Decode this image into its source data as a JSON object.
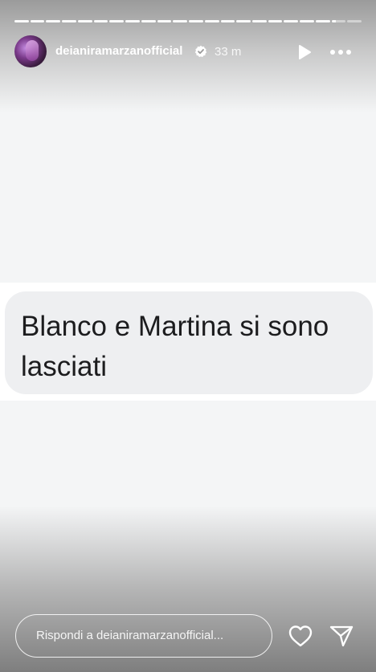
{
  "progress": {
    "segments": 22,
    "current_index": 20
  },
  "header": {
    "username": "deianiramarzanofficial",
    "verified": true,
    "time": "33 m",
    "avatar_icon": "avatar-photo",
    "play_icon": "play-icon",
    "more_icon": "more-horizontal-icon"
  },
  "story": {
    "text": "Blanco e Martina si sono lasciati"
  },
  "footer": {
    "reply_placeholder": "Rispondi a deianiramarzanofficial...",
    "like_icon": "heart-icon",
    "share_icon": "paper-plane-icon"
  },
  "colors": {
    "background": "#f4f5f6",
    "bubble": "#eeeff1",
    "text": "#1c1c1e",
    "overlay_text": "#ffffff"
  }
}
